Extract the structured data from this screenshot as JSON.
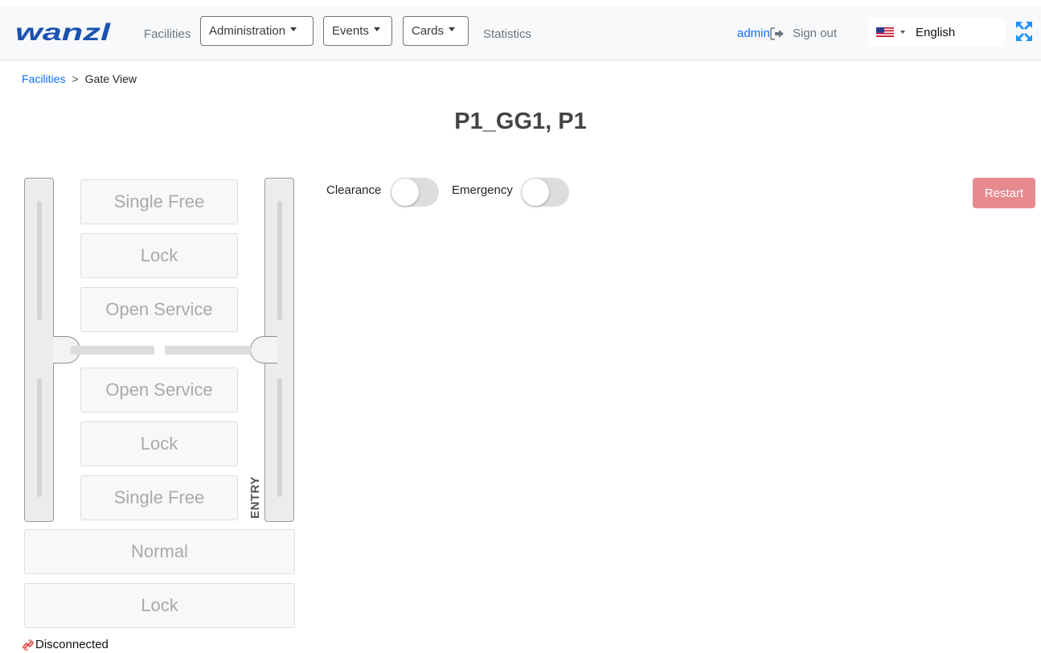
{
  "brand": {
    "logo_text": "wanzl",
    "color": "#1a53b0"
  },
  "nav": {
    "facilities": "Facilities",
    "administration": "Administration",
    "events": "Events",
    "cards": "Cards",
    "statistics": "Statistics"
  },
  "user": {
    "name": "admin",
    "signout_icon": "sign-out-icon",
    "signout": "Sign out"
  },
  "language": {
    "flag_icon": "us-flag-icon",
    "selected": "English"
  },
  "fullscreen_icon": "fullscreen-arrows-icon",
  "breadcrumb": {
    "parent": "Facilities",
    "separator": ">",
    "current": "Gate View"
  },
  "page": {
    "title": "P1_GG1, P1"
  },
  "gate": {
    "top_buttons": [
      "Single Free",
      "Lock",
      "Open Service"
    ],
    "bottom_buttons": [
      "Open Service",
      "Lock",
      "Single Free"
    ],
    "wide_buttons": [
      "Normal",
      "Lock"
    ],
    "entry_label": "ENTRY"
  },
  "controls": {
    "clearance_label": "Clearance",
    "clearance_on": false,
    "emergency_label": "Emergency",
    "emergency_on": false,
    "restart_label": "Restart"
  },
  "status": {
    "icon": "disconnected-plug-icon",
    "text": "Disconnected"
  },
  "colors": {
    "link": "#0d6efd",
    "restart_button": "#e68a90",
    "navbar_bg": "#f8f9fa",
    "disconnected_icon": "#e0443a"
  }
}
